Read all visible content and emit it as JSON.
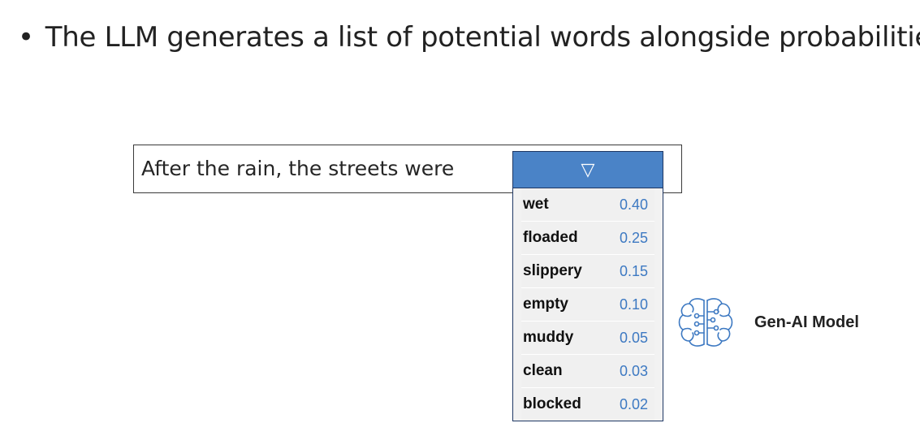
{
  "slide": {
    "bullet_symbol": "•",
    "bullet_text": "The LLM generates a list of potential words alongside probabilities"
  },
  "prompt": {
    "text": "After the rain, the streets were"
  },
  "dropdown": {
    "toggle_symbol": "▽",
    "options": [
      {
        "word": "wet",
        "probability": "0.40"
      },
      {
        "word": "floaded",
        "probability": "0.25"
      },
      {
        "word": "slippery",
        "probability": "0.15"
      },
      {
        "word": "empty",
        "probability": "0.10"
      },
      {
        "word": "muddy",
        "probability": "0.05"
      },
      {
        "word": "clean",
        "probability": "0.03"
      },
      {
        "word": "blocked",
        "probability": "0.02"
      }
    ]
  },
  "model": {
    "label": "Gen-AI Model",
    "icon": "brain-circuit-icon",
    "icon_color": "#3d79c2"
  },
  "colors": {
    "dropdown_header": "#4a83c7",
    "probability_text": "#3d79c2",
    "dropdown_border": "#1f3864"
  }
}
